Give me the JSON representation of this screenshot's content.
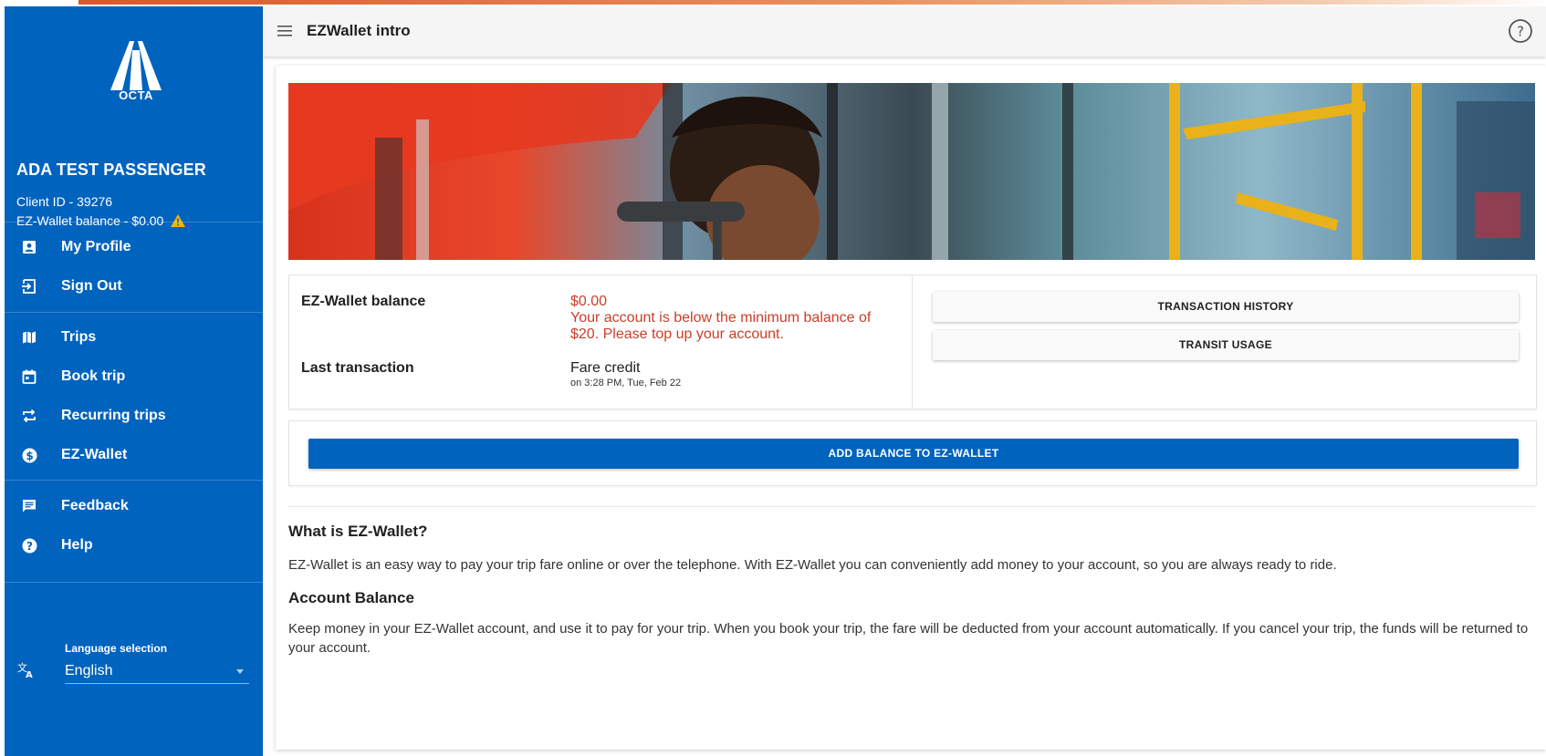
{
  "brand": {
    "logo_text": "OCTA",
    "primary_color": "#0063be",
    "accent_color": "#d9582b",
    "warning_color": "#f5b400"
  },
  "user": {
    "name": "ADA TEST PASSENGER",
    "client_id": "Client ID - 39276",
    "wallet_balance": "EZ-Wallet balance - $0.00",
    "warning_icon": "warning-triangle-icon"
  },
  "nav": {
    "items": [
      {
        "label": "My Profile",
        "icon": "profile-card-icon"
      },
      {
        "label": "Sign Out",
        "icon": "sign-out-icon"
      },
      {
        "label": "Trips",
        "icon": "map-icon"
      },
      {
        "label": "Book trip",
        "icon": "calendar-icon"
      },
      {
        "label": "Recurring trips",
        "icon": "repeat-icon"
      },
      {
        "label": "EZ-Wallet",
        "icon": "dollar-circle-icon"
      },
      {
        "label": "Feedback",
        "icon": "chat-icon"
      },
      {
        "label": "Help",
        "icon": "help-icon"
      }
    ]
  },
  "language": {
    "caption": "Language selection",
    "selected": "English",
    "icon": "translate-icon"
  },
  "header": {
    "title": "EZWallet intro",
    "menu_icon": "hamburger-icon",
    "help_icon": "help-circle-icon"
  },
  "wallet": {
    "balance_label": "EZ-Wallet balance",
    "balance_value": "$0.00",
    "balance_warning_line1": "Your account is below the minimum balance of",
    "balance_warning_line2": "$20. Please top up your account.",
    "last_label": "Last transaction",
    "last_value": "Fare credit",
    "last_time": "on 3:28 PM, Tue, Feb 22",
    "history_button": "TRANSACTION HISTORY",
    "usage_button": "TRANSIT USAGE",
    "add_button": "ADD BALANCE TO EZ-WALLET"
  },
  "content": {
    "what_title": "What is EZ-Wallet?",
    "what_text": "EZ-Wallet is an easy way to pay your trip fare online or over the telephone. With EZ-Wallet you can conveniently add money to your account, so you are always ready to ride.",
    "balance_title": "Account Balance",
    "balance_text": "Keep money in your EZ-Wallet account, and use it to pay for your trip. When you book your trip, the fare will be deducted from your account automatically. If you cancel your trip, the funds will be returned to your account."
  }
}
